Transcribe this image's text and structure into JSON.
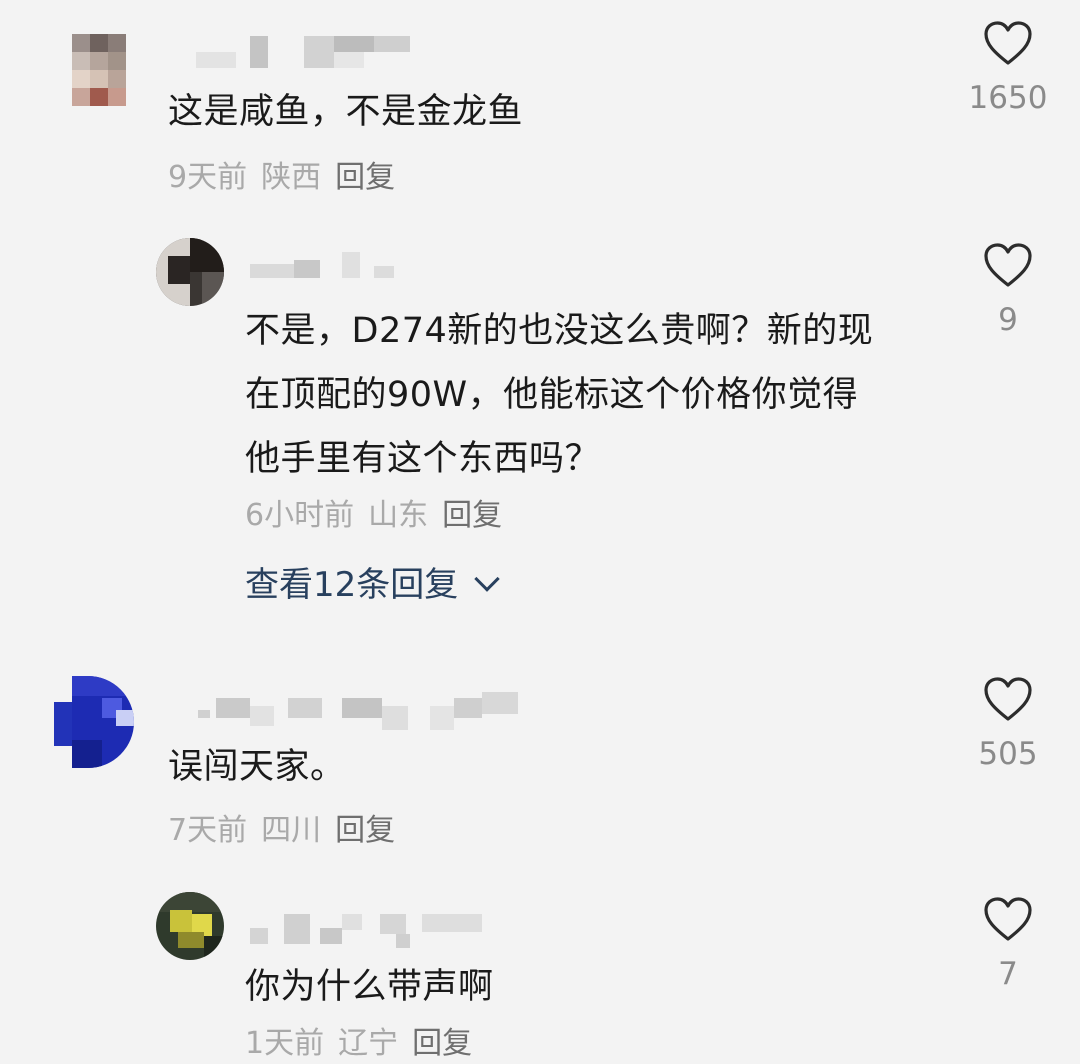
{
  "comments": [
    {
      "text": "这是咸鱼，不是金龙鱼",
      "time": "9天前",
      "location": "陕西",
      "reply_label": "回复",
      "likes": "1650",
      "replies": [
        {
          "text_lines": [
            "不是，D274新的也没这么贵啊？新的现",
            "在顶配的90W，他能标这个价格你觉得",
            "他手里有这个东西吗？"
          ],
          "time": "6小时前",
          "location": "山东",
          "reply_label": "回复",
          "likes": "9"
        }
      ],
      "view_more_label": "查看12条回复"
    },
    {
      "text": "误闯天家。",
      "time": "7天前",
      "location": "四川",
      "reply_label": "回复",
      "likes": "505",
      "replies": [
        {
          "text": "你为什么带声啊",
          "time": "1天前",
          "location": "辽宁",
          "reply_label": "回复",
          "likes": "7"
        }
      ]
    }
  ],
  "icons": {
    "like": "heart-outline-icon",
    "expand": "chevron-down-icon"
  },
  "colors": {
    "background": "#f3f3f3",
    "text": "#1a1a1a",
    "meta": "#a9a9a9",
    "link": "#28405e"
  }
}
